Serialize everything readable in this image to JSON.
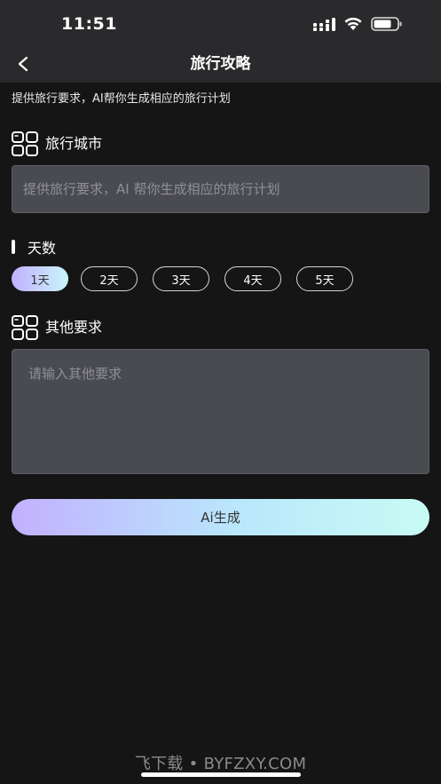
{
  "status_bar": {
    "time": "11:51"
  },
  "nav": {
    "title": "旅行攻略",
    "back_icon": "chevron-left-icon"
  },
  "subtitle": "提供旅行要求，AI帮你生成相应的旅行计划",
  "city_section": {
    "icon": "grid-icon",
    "title": "旅行城市",
    "input_value": "",
    "input_placeholder": "提供旅行要求，AI 帮你生成相应的旅行计划"
  },
  "days_section": {
    "title": "天数",
    "options": [
      "1天",
      "2天",
      "3天",
      "4天",
      "5天"
    ],
    "selected": "1天"
  },
  "other_section": {
    "icon": "grid-icon",
    "title": "其他要求",
    "textarea_value": "",
    "textarea_placeholder": "请输入其他要求"
  },
  "generate_button": {
    "label": "Ai生成"
  },
  "watermark": "飞下载 • BYFZXY.COM",
  "colors": {
    "background": "#151516",
    "header": "#2a2a2c",
    "input_bg": "#4a4b50",
    "gradient_start": "#c2b0ff",
    "gradient_end": "#c9fbf5"
  }
}
